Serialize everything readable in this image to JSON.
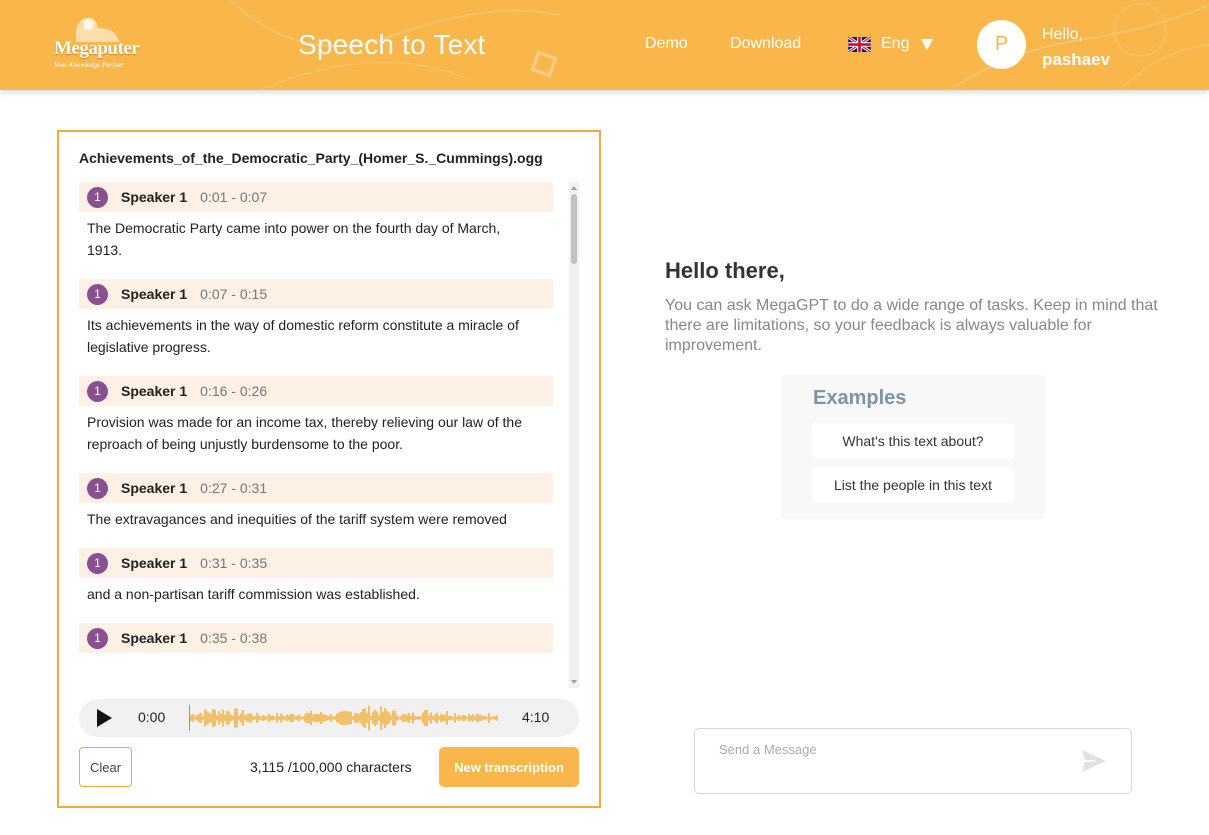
{
  "header": {
    "logo_name": "Megaputer",
    "logo_tagline": "Your Knowledge Partner",
    "app_title": "Speech to Text",
    "nav": {
      "demo_label": "Demo",
      "download_label": "Download"
    },
    "language": {
      "label": "Eng",
      "flag_icon": "uk-flag-icon"
    },
    "user": {
      "avatar_letter": "P",
      "greeting": "Hello,",
      "username": "pashaev"
    },
    "colors": {
      "accent": "#f9b64a",
      "border": "#f2a93b",
      "speaker_badge": "#8a4f8f",
      "segment_bg": "#fdf0e4",
      "waveform": "#f2a61e"
    }
  },
  "transcript_panel": {
    "file_name": "Achievements_of_the_Democratic_Party_(Homer_S._Cummings).ogg",
    "segments": [
      {
        "speaker_num": "1",
        "speaker": "Speaker 1",
        "time": "0:01 - 0:07",
        "text": "The Democratic Party came into power on the fourth day of March, 1913."
      },
      {
        "speaker_num": "1",
        "speaker": "Speaker 1",
        "time": "0:07 - 0:15",
        "text": "Its achievements in the way of domestic reform constitute a miracle of legislative progress."
      },
      {
        "speaker_num": "1",
        "speaker": "Speaker 1",
        "time": "0:16 - 0:26",
        "text": "Provision was made for an income tax, thereby relieving our law of the reproach of being unjustly burdensome to the poor."
      },
      {
        "speaker_num": "1",
        "speaker": "Speaker 1",
        "time": "0:27 - 0:31",
        "text": "The extravagances and inequities of the tariff system were removed"
      },
      {
        "speaker_num": "1",
        "speaker": "Speaker 1",
        "time": "0:31 - 0:35",
        "text": "and a non-partisan tariff commission was established."
      },
      {
        "speaker_num": "1",
        "speaker": "Speaker 1",
        "time": "0:35 - 0:38",
        "text": ""
      }
    ],
    "player": {
      "current_time": "0:00",
      "duration": "4:10",
      "play_icon": "play-icon"
    },
    "clear_label": "Clear",
    "char_count": "3,115 /100,000 characters",
    "new_transcription_label": "New transcription"
  },
  "chat": {
    "hello_title": "Hello there,",
    "hello_desc": "You can ask MegaGPT to do a wide range of tasks. Keep in mind that there are limitations, so your feedback is always valuable for improvement.",
    "examples_title": "Examples",
    "examples": [
      "What's this text about?",
      "List the people in this text"
    ],
    "message_placeholder": "Send a Message",
    "send_icon": "send-icon"
  }
}
